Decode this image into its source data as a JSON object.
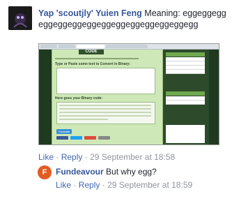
{
  "comment1": {
    "author": "Yap 'scoutjly' Yuien Feng",
    "text": "Meaning: eggeggeggeggeggeggeggeggeggeggeggeggeggegg",
    "attachment_screenshot": {
      "site_logo": "CODE",
      "heading_input": "Type or Paste some text to Convert in Binary:",
      "heading_output": "Here goes your Binary code:",
      "button_label": "Translate",
      "sidebar_heading": "Categories"
    },
    "actions": {
      "like": "Like",
      "reply": "Reply",
      "separator": "·",
      "timestamp": "29 September at 18:58"
    }
  },
  "comment2": {
    "author": "Fundeavour",
    "avatar_letter": "F",
    "text": "But why egg?",
    "actions": {
      "like": "Like",
      "reply": "Reply",
      "separator": "·",
      "timestamp": "29 September at 18:59"
    }
  },
  "colors": {
    "link_blue": "#365899",
    "action_blue": "#4267b2",
    "meta_gray": "#90949c",
    "fundeavour_orange": "#e25b21"
  }
}
